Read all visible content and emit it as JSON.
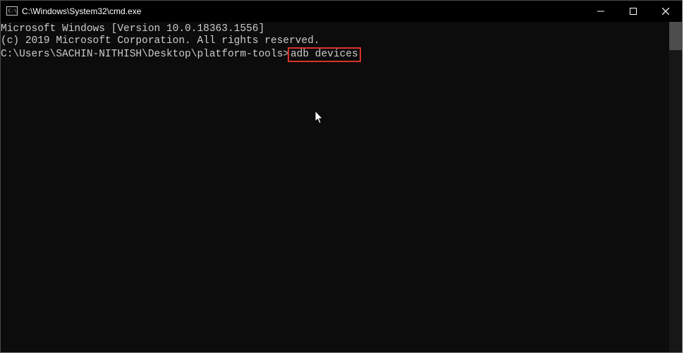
{
  "titlebar": {
    "title": "C:\\Windows\\System32\\cmd.exe",
    "icon_name": "cmd-icon",
    "controls": {
      "minimize": "minimize-icon",
      "maximize": "maximize-icon",
      "close": "close-icon"
    }
  },
  "terminal": {
    "line1": "Microsoft Windows [Version 10.0.18363.1556]",
    "line2": "(c) 2019 Microsoft Corporation. All rights reserved.",
    "blank": "",
    "prompt": "C:\\Users\\SACHIN-NITHISH\\Desktop\\platform-tools>",
    "command": "adb devices"
  },
  "annotation": {
    "highlight_color": "#d9332b"
  }
}
